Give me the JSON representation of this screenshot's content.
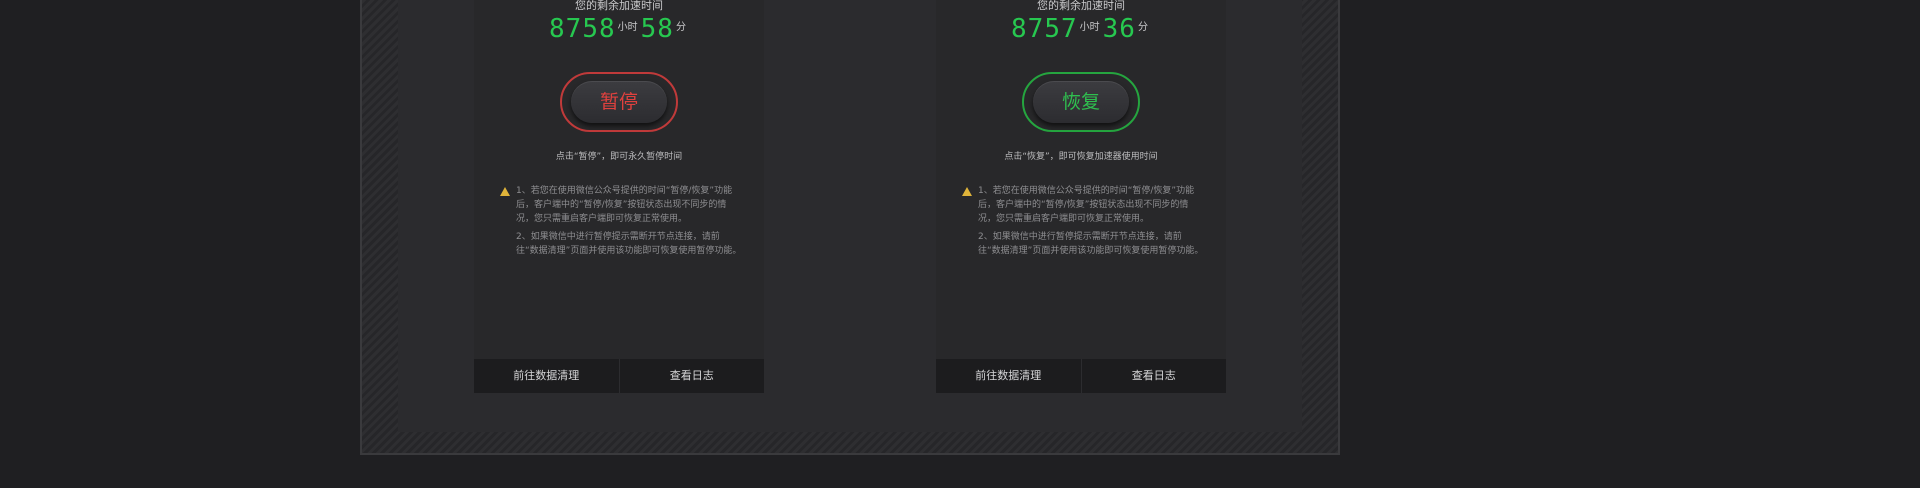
{
  "cards": [
    {
      "title": "您的剩余加速时间",
      "hours": "8758",
      "hours_unit": "小时",
      "minutes": "58",
      "minutes_unit": "分",
      "button_label": "暂停",
      "button_color": "#e0413e",
      "hint": "点击“暂停”，即可永久暂停时间",
      "notes": [
        "1、若您在使用微信公众号提供的时间“暂停/恢复”功能后，客户端中的“暂停/恢复”按钮状态出现不同步的情况，您只需重启客户端即可恢复正常使用。",
        "2、如果微信中进行暂停提示需断开节点连接，请前往“数据清理”页面并使用该功能即可恢复使用暂停功能。"
      ],
      "footer_left": "前往数据清理",
      "footer_right": "查看日志"
    },
    {
      "title": "您的剩余加速时间",
      "hours": "8757",
      "hours_unit": "小时",
      "minutes": "36",
      "minutes_unit": "分",
      "button_label": "恢复",
      "button_color": "#2fbf4f",
      "hint": "点击“恢复”，即可恢复加速器使用时间",
      "notes": [
        "1、若您在使用微信公众号提供的时间“暂停/恢复”功能后，客户端中的“暂停/恢复”按钮状态出现不同步的情况，您只需重启客户端即可恢复正常使用。",
        "2、如果微信中进行暂停提示需断开节点连接，请前往“数据清理”页面并使用该功能即可恢复使用暂停功能。"
      ],
      "footer_left": "前往数据清理",
      "footer_right": "查看日志"
    }
  ],
  "colors": {
    "timer_digits": "#27c850",
    "warning_icon": "#e0b43a"
  }
}
